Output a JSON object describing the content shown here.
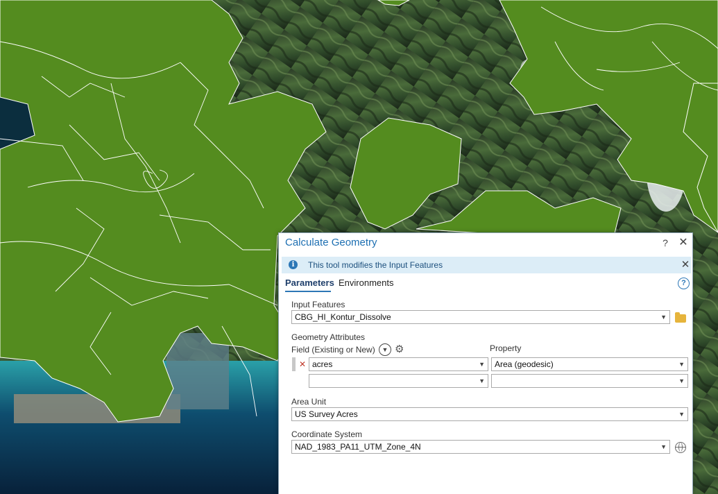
{
  "dialog": {
    "title": "Calculate Geometry",
    "help_glyph": "?",
    "close_glyph": "✕",
    "info_message": "This tool modifies the Input Features",
    "info_icon": "i",
    "tabs": {
      "parameters": "Parameters",
      "environments": "Environments"
    },
    "tab_help_glyph": "?"
  },
  "form": {
    "input_features_label": "Input Features",
    "input_features_value": "CBG_HI_Kontur_Dissolve",
    "geometry_attributes_label": "Geometry Attributes",
    "field_label": "Field (Existing or New)",
    "property_label": "Property",
    "rows": [
      {
        "field": "acres",
        "property": "Area (geodesic)"
      },
      {
        "field": "",
        "property": ""
      }
    ],
    "remove_glyph": "✕",
    "area_unit_label": "Area Unit",
    "area_unit_value": "US Survey Acres",
    "coordinate_system_label": "Coordinate System",
    "coordinate_system_value": "NAD_1983_PA11_UTM_Zone_4N"
  },
  "colors": {
    "polygon_fill": "#548c1f",
    "polygon_stroke": "#ffffff",
    "accent": "#2c77b6"
  },
  "icons": {
    "browse": "folder-icon",
    "coordinate_system": "globe-icon",
    "add_field": "chevron-down-circle-icon",
    "field_settings": "gear-icon",
    "info": "info-icon",
    "remove_row": "close-icon"
  }
}
